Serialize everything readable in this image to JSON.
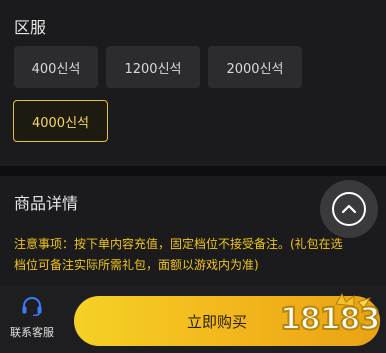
{
  "server": {
    "title": "区服",
    "options": [
      {
        "label": "400신석",
        "selected": false
      },
      {
        "label": "1200신석",
        "selected": false
      },
      {
        "label": "2000신석",
        "selected": false
      },
      {
        "label": "4000신석",
        "selected": true
      }
    ]
  },
  "detail": {
    "title": "商品详情",
    "notice_line1": "注意事项：按下单内容充值，固定档位不接受备注。(礼包在选",
    "notice_line2": "档位可备注实际所需礼包，面额以游戏内为准)"
  },
  "bottom": {
    "support_label": "联系客服",
    "buy_label": "立即购买"
  },
  "watermark": "18183",
  "colors": {
    "accent": "#f0c419",
    "selected_border": "#e3c23b",
    "buy_gradient_start": "#f5d126",
    "buy_gradient_end": "#e9a315"
  },
  "icons": [
    "headset-icon",
    "chevron-up-icon"
  ]
}
